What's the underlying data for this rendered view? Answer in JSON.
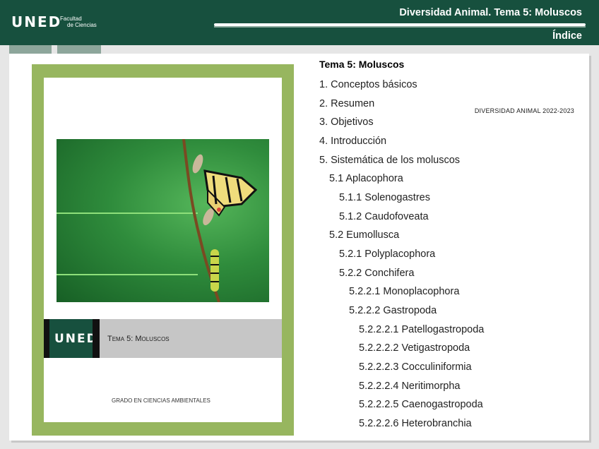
{
  "header": {
    "logo": "UNED",
    "faculty_line1": "Facultad",
    "faculty_line2": "de Ciencias",
    "title": "Diversidad Animal. Tema 5: Moluscos",
    "section": "Índice"
  },
  "cover": {
    "heading": "DIVERSIDAD ANIMAL 2022-2023",
    "logo": "UNED",
    "theme": "Tema 5: Moluscos",
    "grade": "GRADO EN CIENCIAS AMBIENTALES"
  },
  "toc": {
    "title": "Tema 5: Moluscos",
    "items": [
      "1.   Conceptos básicos",
      "2.   Resumen",
      "3.   Objetivos",
      "4.   Introducción",
      "5.   Sistemática de los moluscos",
      "5.1 Aplacophora",
      "5.1.1 Solenogastres",
      "5.1.2 Caudofoveata",
      "5.2 Eumollusca",
      "5.2.1 Polyplacophora",
      "5.2.2 Conchifera",
      "5.2.2.1 Monoplacophora",
      "5.2.2.2 Gastropoda",
      "5.2.2.2.1 Patellogastropoda",
      "5.2.2.2.2 Vetigastropoda",
      "5.2.2.2.3 Cocculiniformia",
      "5.2.2.2.4 Neritimorpha",
      "5.2.2.2.5 Caenogastropoda",
      "5.2.2.2.6 Heterobranchia"
    ]
  },
  "colors": {
    "header_green": "#17503e",
    "cover_border": "#97b65f",
    "photo_green": "#2f8c3c"
  }
}
